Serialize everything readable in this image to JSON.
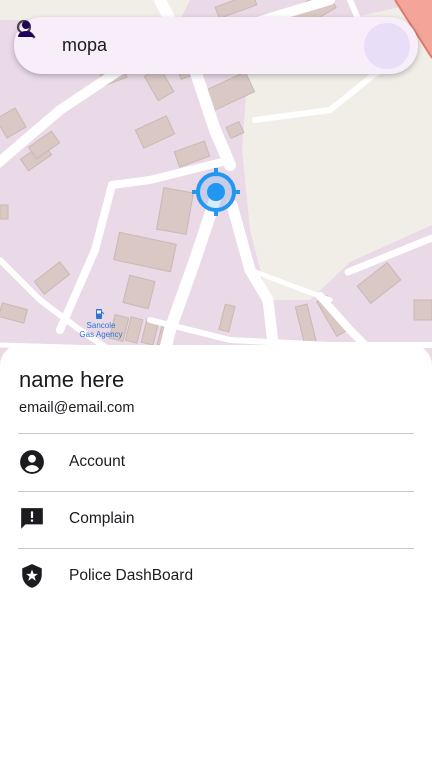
{
  "search": {
    "value": "mopa",
    "icon": "search-icon"
  },
  "profile_button": {
    "icon": "person-icon"
  },
  "map": {
    "place_label_line1": "Sancole",
    "place_label_line2": "Gas Agency",
    "marker_color": "#2196f3"
  },
  "sheet": {
    "name": "name here",
    "email": "email@email.com",
    "items": [
      {
        "label": "Account",
        "icon": "account-circle-icon"
      },
      {
        "label": "Complain",
        "icon": "feedback-icon"
      },
      {
        "label": "Police DashBoard",
        "icon": "police-shield-icon"
      }
    ]
  },
  "colors": {
    "map_background": "#ead9e6",
    "search_background": "#f7eefa",
    "profile_accent": "#e8def8",
    "marker": "#2196f3"
  }
}
